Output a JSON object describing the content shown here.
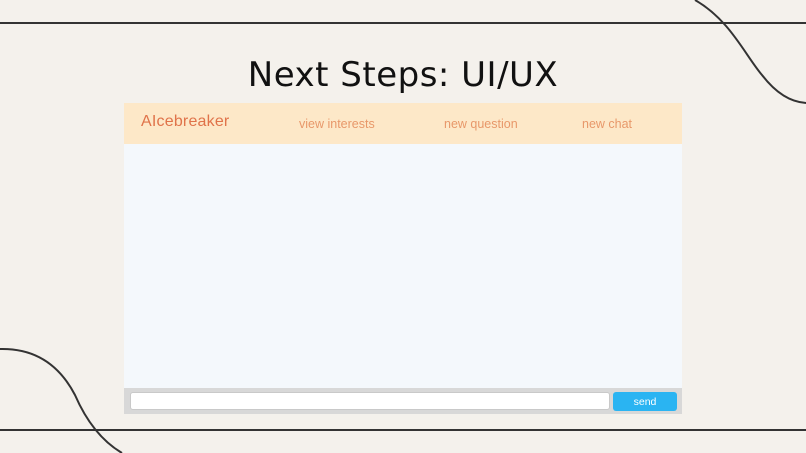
{
  "slide": {
    "title": "Next Steps: UI/UX"
  },
  "app": {
    "brand": "AIcebreaker",
    "nav": {
      "view_interests": "view interests",
      "new_question": "new question",
      "new_chat": "new chat"
    },
    "composer": {
      "input_value": "",
      "send_label": "send"
    },
    "colors": {
      "navbar_bg": "#fde8c8",
      "brand": "#e0734a",
      "nav_link": "#e8986a",
      "send_button": "#2ab4f2",
      "chat_bg": "#f4f8fc"
    }
  }
}
